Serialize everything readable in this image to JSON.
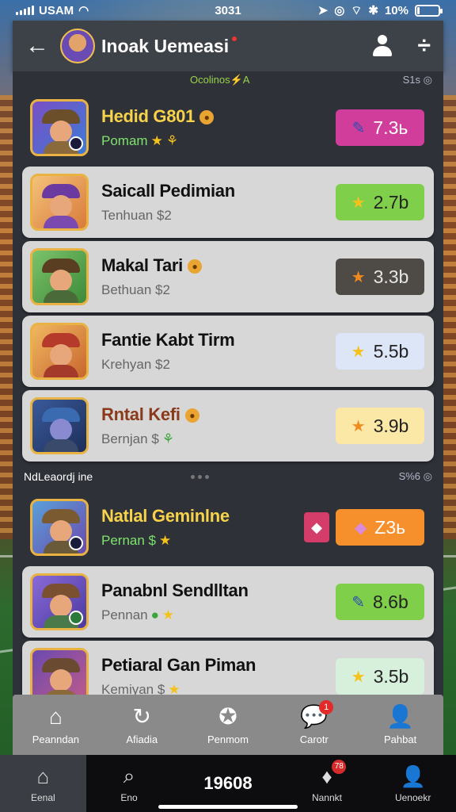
{
  "status": {
    "carrier": "USAM",
    "time": "3031",
    "battery": "10%",
    "battery_level": 0.12
  },
  "header": {
    "title": "Inoak Uemeasi"
  },
  "section1": {
    "label": "Ocolinos⚡A",
    "meta": "S1s ◎"
  },
  "items": [
    {
      "name": "Hedid G801",
      "sub": "Pomam",
      "value": "7.3ь",
      "style": "dark"
    },
    {
      "name": "Saicall Pedimian",
      "sub": "Tenhuan $2",
      "value": "2.7b",
      "style": "light"
    },
    {
      "name": "Makal Tari",
      "sub": "Bethuan $2",
      "value": "3.3b",
      "style": "light"
    },
    {
      "name": "Fantie Kabt Tirm",
      "sub": "Krehyan $2",
      "value": "5.5b",
      "style": "light"
    },
    {
      "name": "Rntal Kefi",
      "sub": "Bernjan $",
      "value": "3.9b",
      "style": "light"
    }
  ],
  "section2": {
    "label": "NdLeaordj ine",
    "meta": "S%6 ◎"
  },
  "items2": [
    {
      "name": "Natlal Geminlne",
      "sub": "Pernan $",
      "value": "Z3ь",
      "style": "dark"
    },
    {
      "name": "Panabnl Sendlltan",
      "sub": "Pennan",
      "value": "8.6b",
      "style": "light"
    },
    {
      "name": "Petiaral Gan Piman",
      "sub": "Kemiyan $",
      "value": "3.5b",
      "style": "light"
    }
  ],
  "tabs": [
    {
      "label": "Peanndan",
      "icon": "home-icon"
    },
    {
      "label": "Afiadia",
      "icon": "refresh-icon"
    },
    {
      "label": "Penmom",
      "icon": "star-icon"
    },
    {
      "label": "Carotr",
      "icon": "chat-icon",
      "badge": "1"
    },
    {
      "label": "Pahbat",
      "icon": "user-icon"
    }
  ],
  "nav": {
    "home": "Eenal",
    "search": "Eno",
    "center": "19608",
    "notify": "Nannkt",
    "notify_badge": "78",
    "profile": "Uenoekr"
  },
  "colors": {
    "pill_magenta": "#d13d9b",
    "pill_green": "#7fcf4a",
    "pill_dark": "#4e4b46",
    "pill_lightblue": "#dde6f6",
    "pill_cream": "#fbe7a6",
    "pill_orange": "#f5902c",
    "pill_mint": "#d6f0dc"
  }
}
